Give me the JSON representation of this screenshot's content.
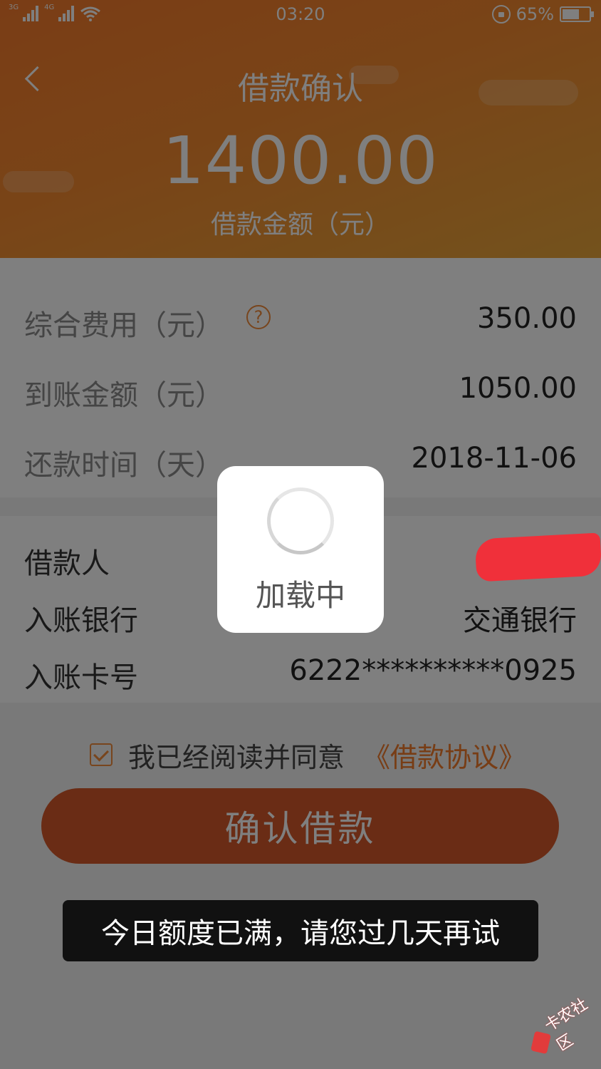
{
  "status_bar": {
    "sim1": "3G",
    "sim2": "4G",
    "time": "03:20",
    "battery_percent": "65%",
    "battery_level": 0.65
  },
  "header": {
    "title": "借款确认",
    "amount": "1400.00",
    "amount_label": "借款金额（元）",
    "gradient_colors": [
      "#f57a2c",
      "#e8a53a"
    ]
  },
  "fees": [
    {
      "label": "综合费用（元）",
      "value": "350.00",
      "help_icon": "question-icon",
      "help_symbol": "?"
    },
    {
      "label": "到账金额（元）",
      "value": "1050.00"
    },
    {
      "label": "还款时间（天）",
      "value": "2018-11-06"
    }
  ],
  "account": [
    {
      "label": "借款人",
      "value": ""
    },
    {
      "label": "入账银行",
      "value": "交通银行"
    },
    {
      "label": "入账卡号",
      "value": "6222**********0925"
    }
  ],
  "agreement": {
    "text": "我已经阅读并同意",
    "link": "《借款协议》",
    "checked": true
  },
  "confirm_button": {
    "label": "确认借款",
    "color": "#d4592a"
  },
  "loading": {
    "text": "加载中"
  },
  "toast": {
    "text": "今日额度已满，请您过几天再试"
  },
  "watermark": {
    "text": "卡农社区"
  },
  "accent_color": "#f07a2a"
}
